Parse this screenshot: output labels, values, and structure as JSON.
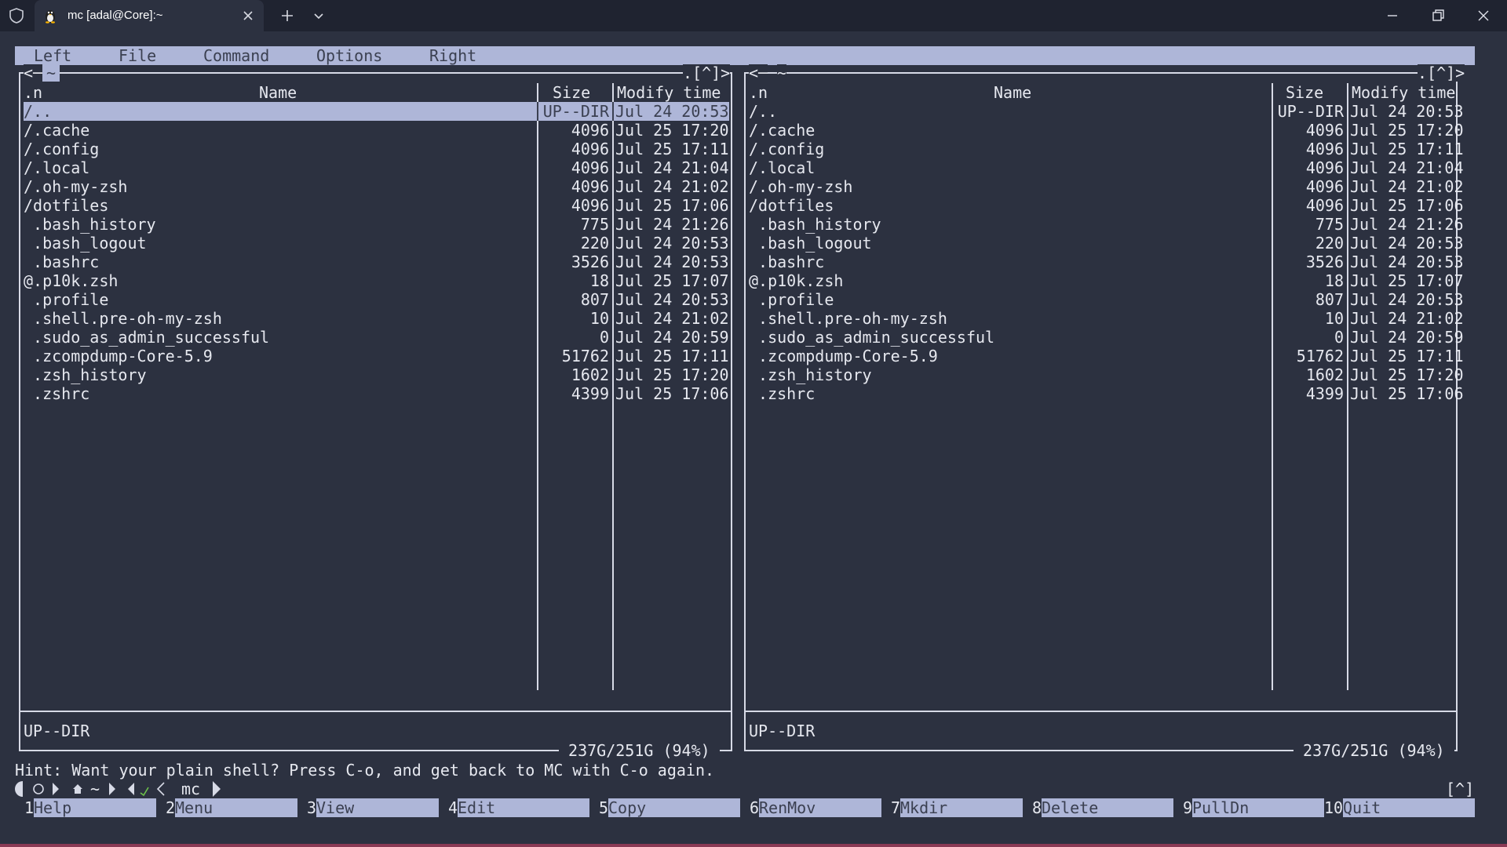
{
  "window": {
    "tab_title": "mc [adal@Core]:~"
  },
  "menubar": {
    "items": [
      "Left",
      "File",
      "Command",
      "Options",
      "Right"
    ]
  },
  "panels": [
    {
      "left_corner": "<─",
      "path": "~",
      "right_corner": ".[^]>",
      "headers": {
        "name_sort": ".n",
        "name": "Name",
        "size": "Size",
        "time": "Modify time"
      },
      "mini_status": "UP--DIR",
      "disk_info": " 237G/251G (94%) "
    },
    {
      "left_corner": "<─",
      "path": "~",
      "right_corner": ".[^]>",
      "headers": {
        "name_sort": ".n",
        "name": "Name",
        "size": "Size",
        "time": "Modify time"
      },
      "mini_status": "UP--DIR",
      "disk_info": " 237G/251G (94%) "
    }
  ],
  "files": [
    {
      "name": "/..",
      "size": "UP--DIR",
      "time": "Jul 24 20:53"
    },
    {
      "name": "/.cache",
      "size": "4096",
      "time": "Jul 25 17:20"
    },
    {
      "name": "/.config",
      "size": "4096",
      "time": "Jul 25 17:11"
    },
    {
      "name": "/.local",
      "size": "4096",
      "time": "Jul 24 21:04"
    },
    {
      "name": "/.oh-my-zsh",
      "size": "4096",
      "time": "Jul 24 21:02"
    },
    {
      "name": "/dotfiles",
      "size": "4096",
      "time": "Jul 25 17:06"
    },
    {
      "name": " .bash_history",
      "size": "775",
      "time": "Jul 24 21:26"
    },
    {
      "name": " .bash_logout",
      "size": "220",
      "time": "Jul 24 20:53"
    },
    {
      "name": " .bashrc",
      "size": "3526",
      "time": "Jul 24 20:53"
    },
    {
      "name": "@.p10k.zsh",
      "size": "18",
      "time": "Jul 25 17:07"
    },
    {
      "name": " .profile",
      "size": "807",
      "time": "Jul 24 20:53"
    },
    {
      "name": " .shell.pre-oh-my-zsh",
      "size": "10",
      "time": "Jul 24 21:02"
    },
    {
      "name": " .sudo_as_admin_successful",
      "size": "0",
      "time": "Jul 24 20:59"
    },
    {
      "name": " .zcompdump-Core-5.9",
      "size": "51762",
      "time": "Jul 25 17:11"
    },
    {
      "name": " .zsh_history",
      "size": "1602",
      "time": "Jul 25 17:20"
    },
    {
      "name": " .zshrc",
      "size": "4399",
      "time": "Jul 25 17:06"
    }
  ],
  "hint": "Hint: Want your plain shell? Press C-o, and get back to MC with C-o again.",
  "prompt": {
    "home": "~",
    "command": "mc",
    "up_mark": "[^]"
  },
  "fkeys": [
    {
      "num": "1",
      "label": "Help"
    },
    {
      "num": "2",
      "label": "Menu"
    },
    {
      "num": "3",
      "label": "View"
    },
    {
      "num": "4",
      "label": "Edit"
    },
    {
      "num": "5",
      "label": "Copy"
    },
    {
      "num": "6",
      "label": "RenMov"
    },
    {
      "num": "7",
      "label": "Mkdir"
    },
    {
      "num": "8",
      "label": "Delete"
    },
    {
      "num": "9",
      "label": "PullDn"
    },
    {
      "num": "10",
      "label": "Quit"
    }
  ],
  "colors": {
    "background": "#2c3140",
    "highlight": "#aeb6d8",
    "highlight_text": "#3b4051",
    "text": "#e6e8ef"
  }
}
